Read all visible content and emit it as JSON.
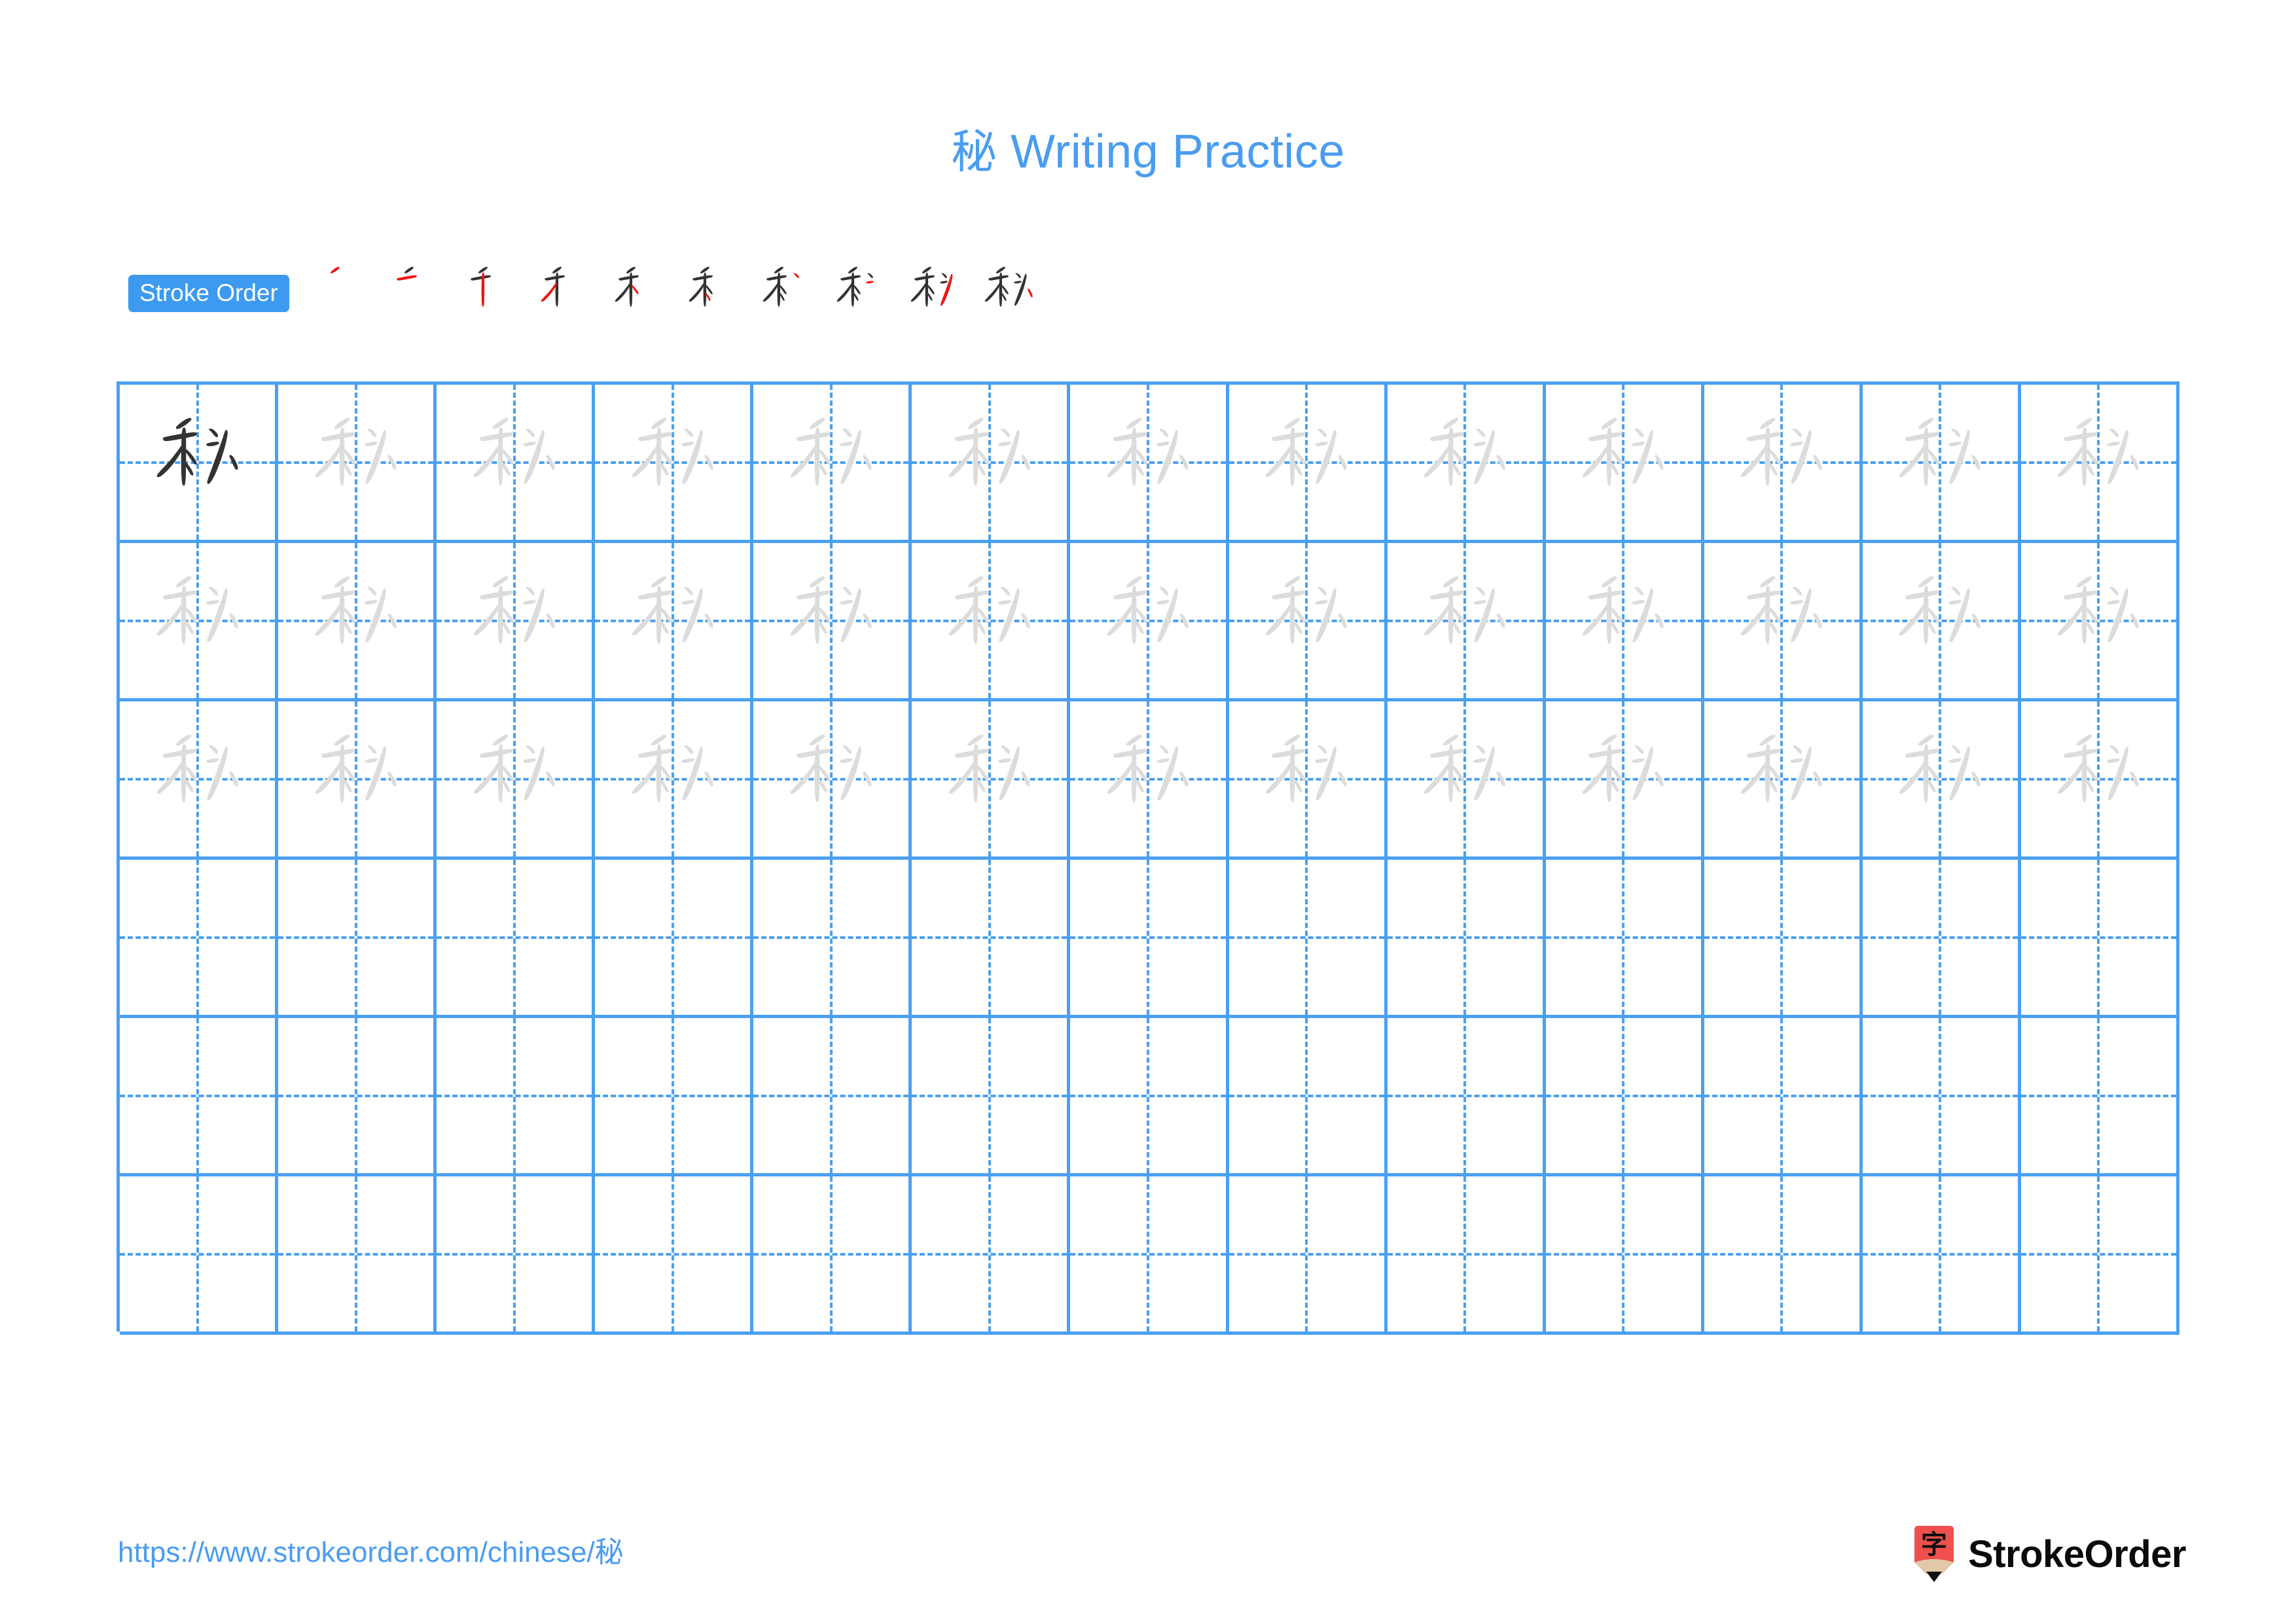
{
  "document": {
    "character": "秘",
    "title": "秘 Writing Practice",
    "title_prefix": "秘",
    "title_suffix": " Writing Practice"
  },
  "stroke_order": {
    "label": "Stroke Order",
    "total_strokes": 10,
    "new_stroke_color": "#f01414",
    "old_stroke_color": "#333333",
    "steps": [
      {
        "step": 1,
        "strokes_shown": 1
      },
      {
        "step": 2,
        "strokes_shown": 2
      },
      {
        "step": 3,
        "strokes_shown": 3
      },
      {
        "step": 4,
        "strokes_shown": 4
      },
      {
        "step": 5,
        "strokes_shown": 5
      },
      {
        "step": 6,
        "strokes_shown": 6
      },
      {
        "step": 7,
        "strokes_shown": 7
      },
      {
        "step": 8,
        "strokes_shown": 8
      },
      {
        "step": 9,
        "strokes_shown": 9
      },
      {
        "step": 10,
        "strokes_shown": 10
      }
    ]
  },
  "grid": {
    "columns": 13,
    "rows": 6,
    "line_color": "#4aa0f2",
    "guide_color": "#dcdcdc",
    "model_color": "#333333",
    "cells": [
      [
        "model",
        "trace",
        "trace",
        "trace",
        "trace",
        "trace",
        "trace",
        "trace",
        "trace",
        "trace",
        "trace",
        "trace",
        "trace"
      ],
      [
        "trace",
        "trace",
        "trace",
        "trace",
        "trace",
        "trace",
        "trace",
        "trace",
        "trace",
        "trace",
        "trace",
        "trace",
        "trace"
      ],
      [
        "trace",
        "trace",
        "trace",
        "trace",
        "trace",
        "trace",
        "trace",
        "trace",
        "trace",
        "trace",
        "trace",
        "trace",
        "trace"
      ],
      [
        "empty",
        "empty",
        "empty",
        "empty",
        "empty",
        "empty",
        "empty",
        "empty",
        "empty",
        "empty",
        "empty",
        "empty",
        "empty"
      ],
      [
        "empty",
        "empty",
        "empty",
        "empty",
        "empty",
        "empty",
        "empty",
        "empty",
        "empty",
        "empty",
        "empty",
        "empty",
        "empty"
      ],
      [
        "empty",
        "empty",
        "empty",
        "empty",
        "empty",
        "empty",
        "empty",
        "empty",
        "empty",
        "empty",
        "empty",
        "empty",
        "empty"
      ]
    ]
  },
  "footer": {
    "url": "https://www.strokeorder.com/chinese/秘",
    "url_prefix": "https://www.strokeorder.com/chinese/",
    "url_character": "秘",
    "brand_name": "StrokeOrder",
    "logo_character": "字",
    "logo_body_color": "#f0504d",
    "logo_wood_color": "#e3c9a8",
    "logo_tip_color": "#111111"
  }
}
